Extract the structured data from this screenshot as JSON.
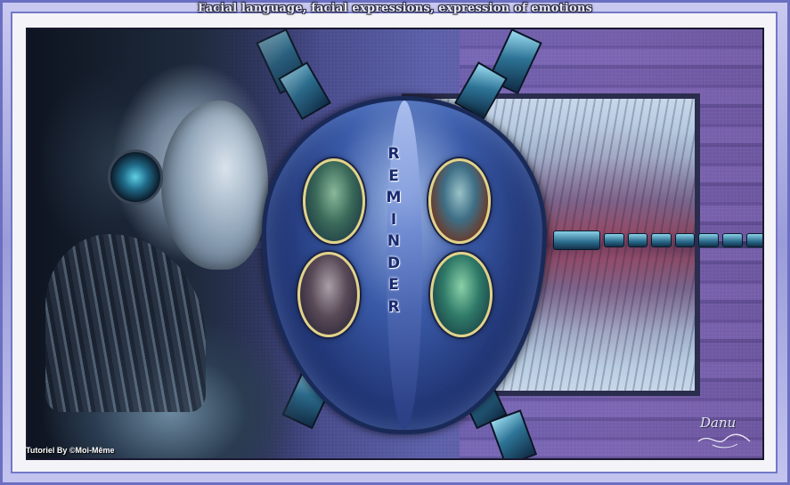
{
  "title": "Facial language, facial expressions, expression of emotions",
  "emblem": {
    "word": "REMINDER",
    "letters": [
      "R",
      "E",
      "M",
      "I",
      "N",
      "D",
      "E",
      "R"
    ]
  },
  "credit": "Tutoriel By ©Moi-Même",
  "signature": "Danu",
  "colors": {
    "frame": "#9a9cd9",
    "frame_border": "#6b6fc2",
    "portrait_border": "#e2d38a",
    "emblem_text": "#1a2a70"
  }
}
